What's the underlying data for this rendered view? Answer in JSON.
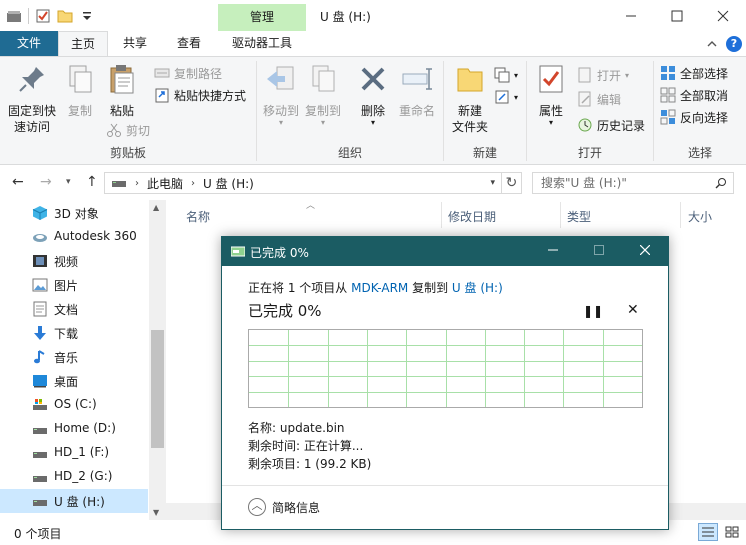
{
  "window": {
    "title": "U 盘 (H:)",
    "context_tab": "管理"
  },
  "tabs": {
    "file": "文件",
    "home": "主页",
    "share": "共享",
    "view": "查看",
    "drive_tools": "驱动器工具"
  },
  "ribbon": {
    "clipboard": {
      "label": "剪贴板",
      "pin": "固定到快\n速访问",
      "pin_l1": "固定到快",
      "pin_l2": "速访问",
      "copy": "复制",
      "paste": "粘贴",
      "copy_path": "复制路径",
      "paste_shortcut": "粘贴快捷方式",
      "cut": "剪切"
    },
    "organize": {
      "label": "组织",
      "move_to": "移动到",
      "copy_to": "复制到",
      "delete": "删除",
      "rename": "重命名"
    },
    "new": {
      "label": "新建",
      "new_folder_l1": "新建",
      "new_folder_l2": "文件夹"
    },
    "open": {
      "label": "打开",
      "properties": "属性",
      "open": "打开",
      "edit": "编辑",
      "history": "历史记录"
    },
    "select": {
      "label": "选择",
      "select_all": "全部选择",
      "select_none": "全部取消",
      "invert": "反向选择"
    }
  },
  "address": {
    "crumb1": "此电脑",
    "crumb2": "U 盘 (H:)",
    "search_placeholder": "搜索\"U 盘 (H:)\""
  },
  "nav": {
    "items": [
      {
        "label": "3D 对象"
      },
      {
        "label": "Autodesk 360"
      },
      {
        "label": "视频"
      },
      {
        "label": "图片"
      },
      {
        "label": "文档"
      },
      {
        "label": "下载"
      },
      {
        "label": "音乐"
      },
      {
        "label": "桌面"
      },
      {
        "label": "OS (C:)"
      },
      {
        "label": "Home (D:)"
      },
      {
        "label": "HD_1 (F:)"
      },
      {
        "label": "HD_2 (G:)"
      },
      {
        "label": "U 盘 (H:)"
      }
    ]
  },
  "columns": {
    "name": "名称",
    "modified": "修改日期",
    "type": "类型",
    "size": "大小"
  },
  "status": {
    "count": "0 个项目"
  },
  "dialog": {
    "title": "已完成 0%",
    "line_prefix": "正在将 1 个项目从 ",
    "source": "MDK-ARM",
    "line_mid": " 复制到 ",
    "dest": "U 盘 (H:)",
    "percent": "已完成 0%",
    "name_line": "名称: update.bin",
    "time_line": "剩余时间: 正在计算...",
    "items_line": "剩余项目: 1 (99.2 KB)",
    "less_details": "简略信息",
    "progress_fraction": 0
  },
  "colors": {
    "file_tab": "#1f6b93",
    "context_tab": "#c6efbd",
    "dialog_title": "#1b5c63",
    "link": "#0063b1",
    "selection": "#cce8ff",
    "graph_grid": "#a8e0a8"
  }
}
